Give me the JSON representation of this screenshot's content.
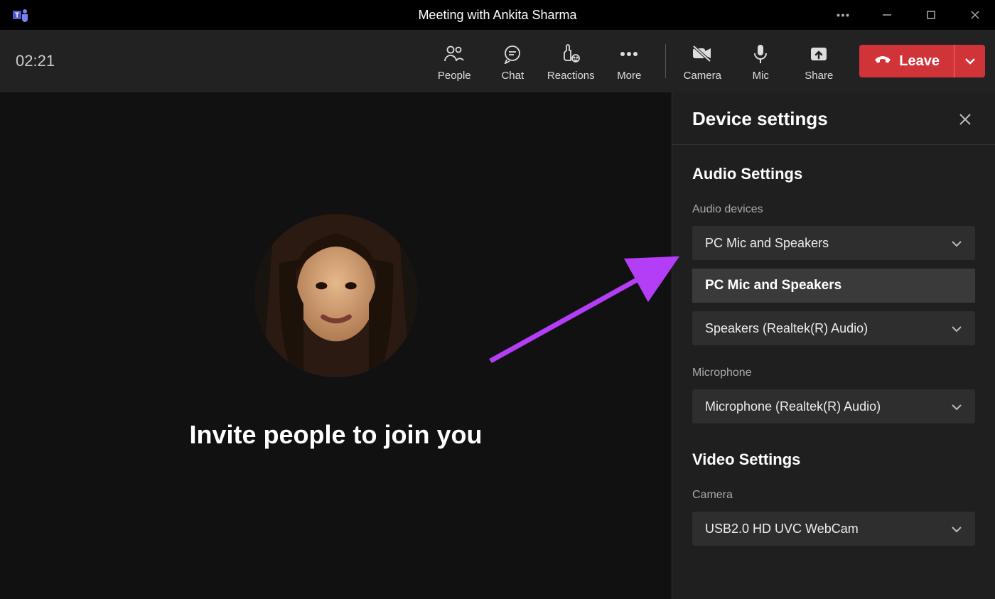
{
  "titlebar": {
    "title": "Meeting with Ankita Sharma"
  },
  "toolbar": {
    "timer": "02:21",
    "people_label": "People",
    "chat_label": "Chat",
    "reactions_label": "Reactions",
    "more_label": "More",
    "camera_label": "Camera",
    "mic_label": "Mic",
    "share_label": "Share",
    "leave_label": "Leave"
  },
  "stage": {
    "invite_text": "Invite people to join you"
  },
  "panel": {
    "title": "Device settings",
    "audio_section": "Audio Settings",
    "audio_devices_label": "Audio devices",
    "audio_device_selected": "PC Mic and Speakers",
    "audio_device_expanded": "PC Mic and Speakers",
    "speaker_selected": "Speakers (Realtek(R) Audio)",
    "mic_label": "Microphone",
    "mic_selected": "Microphone (Realtek(R) Audio)",
    "video_section": "Video Settings",
    "camera_label": "Camera",
    "camera_selected": "USB2.0 HD UVC WebCam"
  }
}
